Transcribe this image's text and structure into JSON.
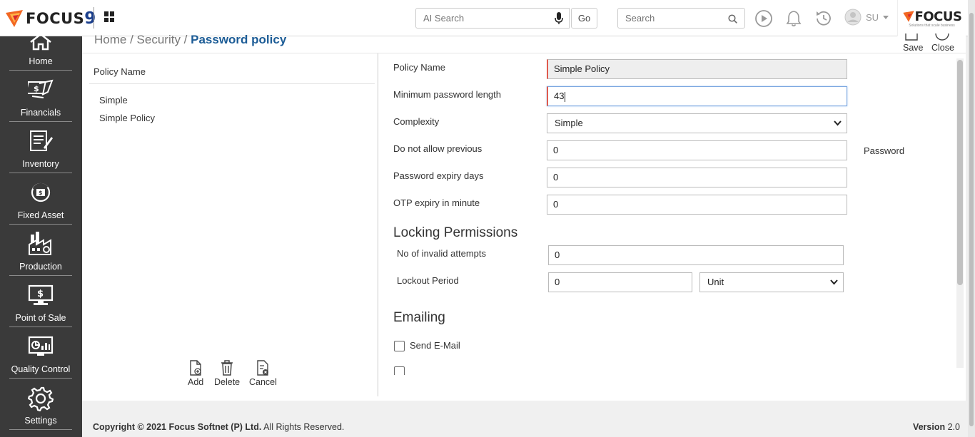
{
  "topbar": {
    "logo_text": "FOCUS",
    "logo_num": "9",
    "ai_search_placeholder": "AI Search",
    "go_label": "Go",
    "search_placeholder": "Search",
    "user_initials": "SU",
    "brand_text": "FOCUS",
    "brand_tagline": "Solutions that scale business"
  },
  "sidebar": {
    "items": [
      {
        "label": "Home",
        "icon": "home-icon"
      },
      {
        "label": "Financials",
        "icon": "financials-icon"
      },
      {
        "label": "Inventory",
        "icon": "inventory-icon"
      },
      {
        "label": "Fixed Asset",
        "icon": "fixed-asset-icon"
      },
      {
        "label": "Production",
        "icon": "production-icon"
      },
      {
        "label": "Point of Sale",
        "icon": "point-of-sale-icon"
      },
      {
        "label": "Quality Control",
        "icon": "quality-control-icon"
      },
      {
        "label": "Settings",
        "icon": "settings-icon"
      }
    ]
  },
  "breadcrumb": {
    "home": "Home /",
    "security": "Security /",
    "current": "Password policy"
  },
  "actions": {
    "save": "Save",
    "close": "Close"
  },
  "left_panel": {
    "header": "Policy Name",
    "items": [
      "Simple",
      "Simple Policy"
    ],
    "add": "Add",
    "delete": "Delete",
    "cancel": "Cancel"
  },
  "form": {
    "policy_name_label": "Policy Name",
    "policy_name_value": "Simple Policy",
    "min_length_label": "Minimum password length",
    "min_length_value": "43",
    "complexity_label": "Complexity",
    "complexity_value": "Simple",
    "do_not_allow_label": "Do not allow previous",
    "do_not_allow_value": "0",
    "do_not_allow_suffix": "Password",
    "expiry_days_label": "Password expiry days",
    "expiry_days_value": "0",
    "otp_label": "OTP expiry in minute",
    "otp_value": "0",
    "locking_heading": "Locking Permissions",
    "invalid_attempts_label": "No of invalid attempts",
    "invalid_attempts_value": "0",
    "lockout_label": "Lockout Period",
    "lockout_value": "0",
    "lockout_unit": "Unit",
    "emailing_heading": "Emailing",
    "send_email_label": "Send E-Mail"
  },
  "footer": {
    "copyright_prefix": "Copyright © 2021",
    "company": "Focus Softnet (P) Ltd.",
    "rights": "All Rights Reserved.",
    "version_label": "Version",
    "version_value": "2.0"
  }
}
